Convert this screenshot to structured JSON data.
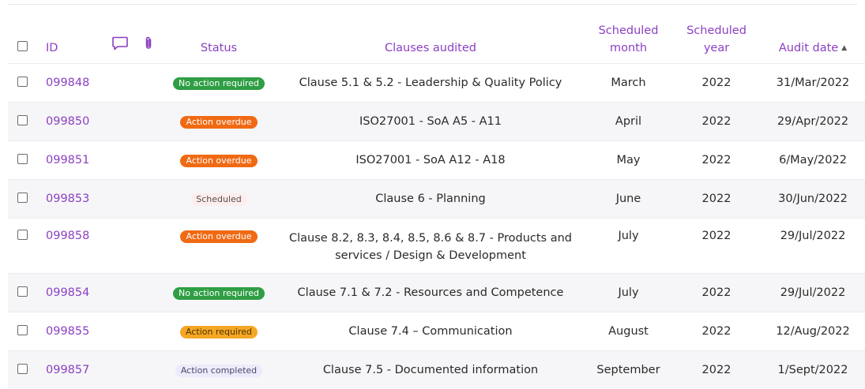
{
  "table": {
    "headers": {
      "id": "ID",
      "status": "Status",
      "clauses": "Clauses audited",
      "month_line1": "Scheduled",
      "month_line2": "month",
      "year_line1": "Scheduled",
      "year_line2": "year",
      "date": "Audit date",
      "sort_indicator": "▲"
    },
    "header_icons": [
      "comment-icon",
      "paperclip-icon"
    ],
    "rows": [
      {
        "id": "099848",
        "status": "No action required",
        "status_color": "green",
        "clause": "Clause 5.1 & 5.2 - Leadership & Quality Policy",
        "clause_line2": "",
        "month": "March",
        "year": "2022",
        "date": "31/Mar/2022"
      },
      {
        "id": "099850",
        "status": "Action overdue",
        "status_color": "orange",
        "clause": "ISO27001 - SoA A5 - A11",
        "clause_line2": "",
        "month": "April",
        "year": "2022",
        "date": "29/Apr/2022"
      },
      {
        "id": "099851",
        "status": "Action overdue",
        "status_color": "orange",
        "clause": "ISO27001 - SoA A12 - A18",
        "clause_line2": "",
        "month": "May",
        "year": "2022",
        "date": "6/May/2022"
      },
      {
        "id": "099853",
        "status": "Scheduled",
        "status_color": "pink",
        "clause": "Clause 6 - Planning",
        "clause_line2": "",
        "month": "June",
        "year": "2022",
        "date": "30/Jun/2022"
      },
      {
        "id": "099858",
        "status": "Action overdue",
        "status_color": "orange",
        "clause": "Clause 8.2, 8.3, 8.4, 8.5, 8.6 & 8.7 - Products and",
        "clause_line2": "services / Design & Development",
        "month": "July",
        "year": "2022",
        "date": "29/Jul/2022"
      },
      {
        "id": "099854",
        "status": "No action required",
        "status_color": "green",
        "clause": "Clause 7.1 & 7.2 - Resources and Competence",
        "clause_line2": "",
        "month": "July",
        "year": "2022",
        "date": "29/Jul/2022"
      },
      {
        "id": "099855",
        "status": "Action required",
        "status_color": "amber",
        "clause": "Clause 7.4 – Communication",
        "clause_line2": "",
        "month": "August",
        "year": "2022",
        "date": "12/Aug/2022"
      },
      {
        "id": "099857",
        "status": "Action completed",
        "status_color": "lavender",
        "clause": "Clause 7.5 - Documented information",
        "clause_line2": "",
        "month": "September",
        "year": "2022",
        "date": "1/Sept/2022"
      }
    ]
  },
  "colors": {
    "accent": "#8b3fc2",
    "green": "#2f9e44",
    "orange": "#f06a14",
    "amber": "#f5a623",
    "pink": "#fdeeee",
    "lavender": "#ecebfb"
  }
}
